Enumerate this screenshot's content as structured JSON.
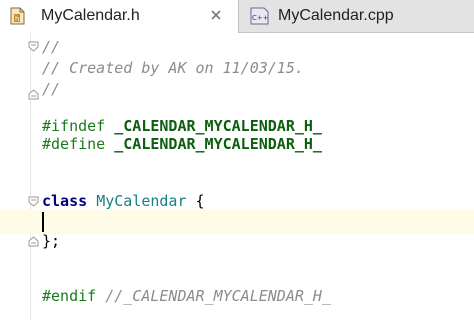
{
  "tabs": [
    {
      "label": "MyCalendar.h",
      "icon": "header-file-icon",
      "active": true
    },
    {
      "label": "MyCalendar.cpp",
      "icon": "cpp-file-icon",
      "active": false
    }
  ],
  "cpp_badge": "C++",
  "code": {
    "comment_open": "//",
    "comment_created": "// Created by AK on 11/03/15.",
    "comment_close": "//",
    "ifndef_kw": "#ifndef",
    "ifndef_macro": "_CALENDAR_MYCALENDAR_H_",
    "define_kw": "#define",
    "define_macro": "_CALENDAR_MYCALENDAR_H_",
    "class_kw": "class",
    "class_name": "MyCalendar",
    "class_brace": "{",
    "close_brace": "};",
    "endif_kw": "#endif",
    "endif_comment": "//_CALENDAR_MYCALENDAR_H_"
  },
  "colors": {
    "comment": "#8c8c8c",
    "directive": "#1b7b1b",
    "keyword": "#000080",
    "class_name": "#1a7f7f",
    "current_line": "#fefbe7"
  }
}
